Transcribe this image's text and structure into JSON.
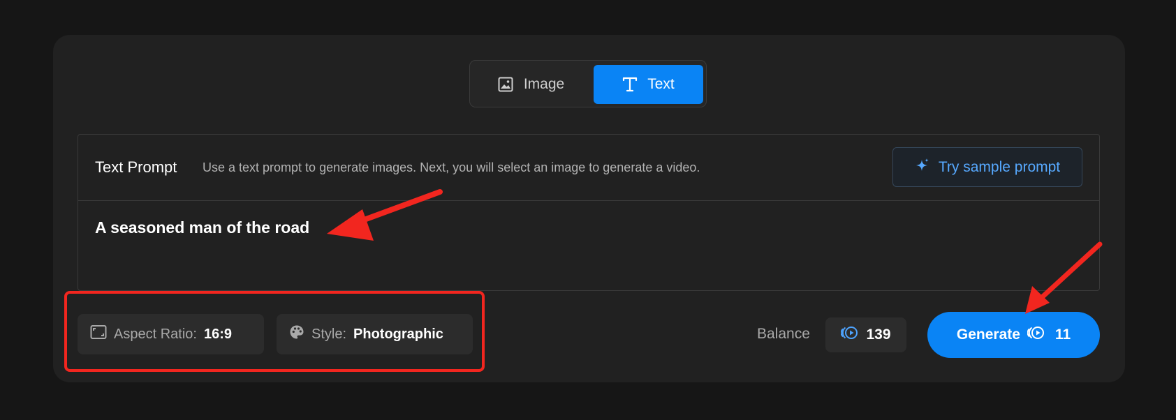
{
  "mode_toggle": {
    "tabs": [
      {
        "label": "Image",
        "icon": "image-icon",
        "active": false
      },
      {
        "label": "Text",
        "icon": "text-icon",
        "active": true
      }
    ]
  },
  "prompt": {
    "title": "Text Prompt",
    "description": "Use a text prompt to generate images. Next, you will select an image to generate a video.",
    "sample_button_label": "Try sample prompt",
    "sample_button_icon": "sparkle-icon",
    "value": "A seasoned man of the road"
  },
  "options": {
    "aspect_ratio": {
      "label": "Aspect Ratio:",
      "value": "16:9",
      "icon": "aspect-ratio-icon"
    },
    "style": {
      "label": "Style:",
      "value": "Photographic",
      "icon": "palette-icon"
    }
  },
  "balance": {
    "label": "Balance",
    "value": "139",
    "icon": "credits-icon"
  },
  "generate": {
    "label": "Generate",
    "cost": "11",
    "icon": "credits-icon"
  },
  "colors": {
    "accent": "#0a84f5",
    "background": "#161616",
    "card": "#212121",
    "annotation": "#f2261f",
    "link": "#57a9ff"
  }
}
